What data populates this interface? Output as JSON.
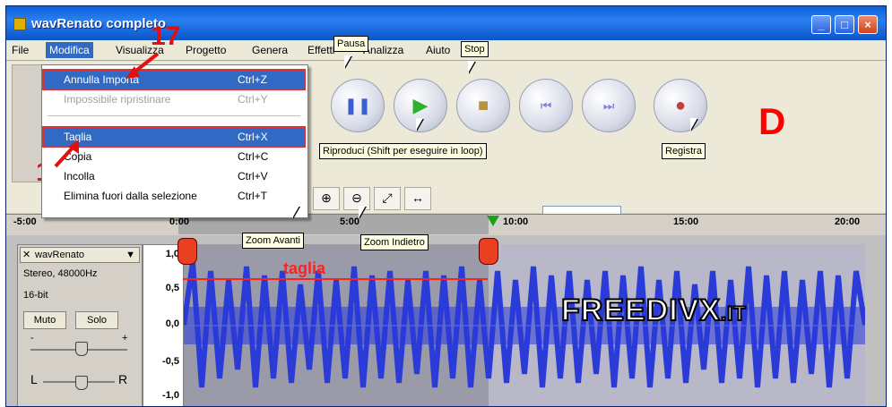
{
  "window": {
    "title": "wavRenato completo",
    "min_glyph": "_",
    "max_glyph": "□",
    "close_glyph": "×"
  },
  "menubar": {
    "items": [
      "File",
      "Modifica",
      "Visualizza",
      "Progetto",
      "Genera",
      "Effetti",
      "Analizza",
      "Aiuto"
    ]
  },
  "edit_menu": {
    "items": [
      {
        "label": "Annulla Importa",
        "shortcut": "Ctrl+Z",
        "state": "highlighted"
      },
      {
        "label": "Impossibile ripristinare",
        "shortcut": "Ctrl+Y",
        "state": "disabled"
      },
      {
        "label": "Taglia",
        "shortcut": "Ctrl+X",
        "state": "highlighted"
      },
      {
        "label": "Copia",
        "shortcut": "Ctrl+C",
        "state": "normal"
      },
      {
        "label": "Incolla",
        "shortcut": "Ctrl+V",
        "state": "normal"
      },
      {
        "label": "Elimina fuori dalla selezione",
        "shortcut": "Ctrl+T",
        "state": "normal"
      }
    ]
  },
  "annotations": {
    "step_17": "17",
    "step_16": "16",
    "letter_d": "D",
    "taglia": "taglia"
  },
  "tooltips": {
    "pausa": "Pausa",
    "stop": "Stop",
    "riproduci": "Riproduci (Shift per eseguire in loop)",
    "registra": "Registra",
    "zoom_avanti": "Zoom Avanti",
    "zoom_indietro": "Zoom Indietro"
  },
  "transport": {
    "pause_icon": "pause-icon",
    "play_icon": "play-icon",
    "stop_icon": "stop-icon",
    "skip_start_icon": "skip-start-icon",
    "skip_end_icon": "skip-end-icon",
    "record_icon": "record-icon",
    "colors": {
      "pause": "#3b5fd0",
      "play": "#2eb12e",
      "stop": "#b8923a",
      "skip": "#8080e0",
      "record": "#c04040"
    }
  },
  "ruler": {
    "ticks": [
      "-5:00",
      "0:00",
      "5:00",
      "10:00",
      "15:00",
      "20:00"
    ]
  },
  "track": {
    "name": "wavRenato",
    "format": "Stereo, 48000Hz",
    "bits": "16-bit",
    "mute": "Muto",
    "solo": "Solo",
    "gain_minus": "-",
    "gain_plus": "+",
    "pan_left": "L",
    "pan_right": "R",
    "scale": [
      "1,0",
      "0,5",
      "0,0",
      "-0,5",
      "-1,0"
    ]
  },
  "logo": {
    "main": "FREEDIVX",
    "suffix": ".IT"
  },
  "colors": {
    "wave_blue": "#2a3bd8",
    "selection_gray": "#a8a8a8",
    "annotation_red": "#e01010"
  }
}
